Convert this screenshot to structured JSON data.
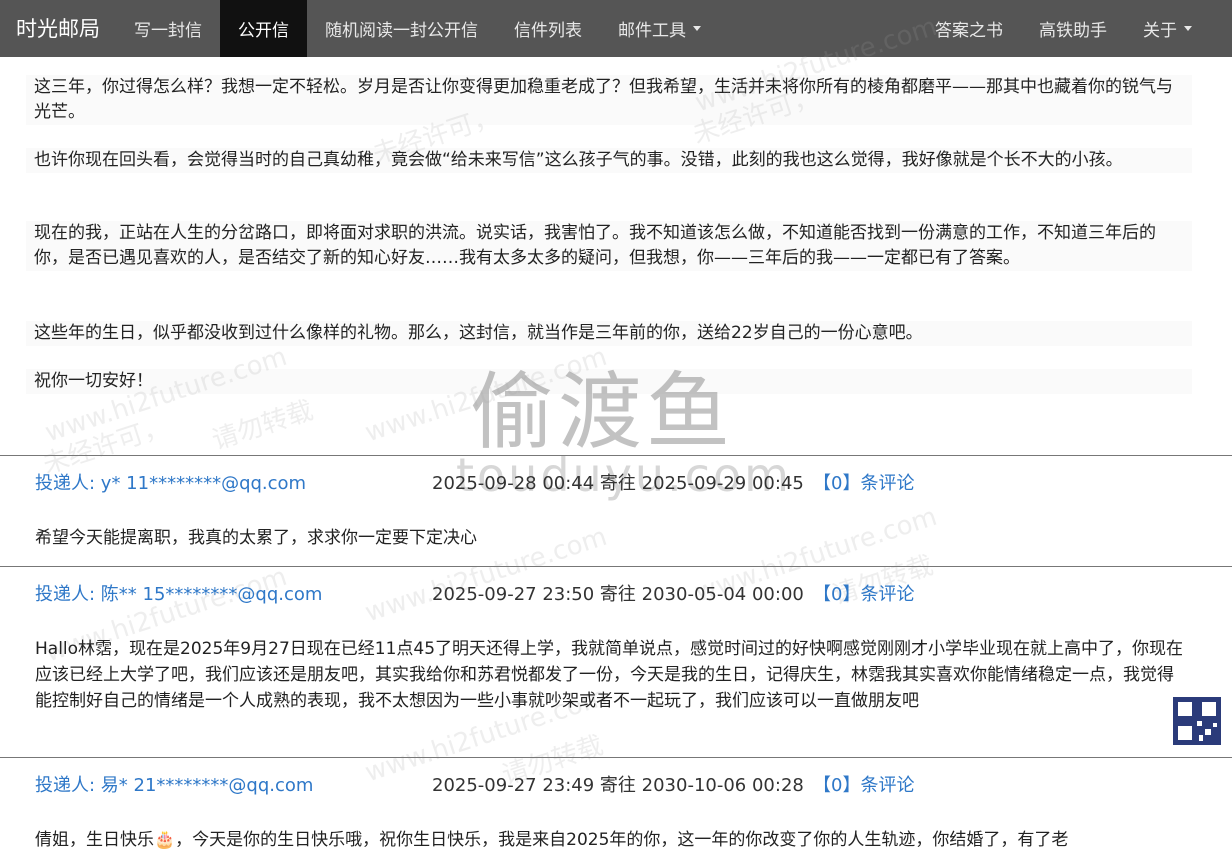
{
  "navbar": {
    "brand": "时光邮局",
    "items": [
      {
        "label": "写一封信"
      },
      {
        "label": "公开信",
        "active": true
      },
      {
        "label": "随机阅读一封公开信"
      },
      {
        "label": "信件列表"
      },
      {
        "label": "邮件工具",
        "dropdown": true
      }
    ],
    "right_items": [
      {
        "label": "答案之书"
      },
      {
        "label": "高铁助手"
      },
      {
        "label": "关于",
        "dropdown": true
      }
    ]
  },
  "letter": {
    "paragraphs": [
      "这三年，你过得怎么样？我想一定不轻松。岁月是否让你变得更加稳重老成了？但我希望，生活并未将你所有的棱角都磨平——那其中也藏着你的锐气与光芒。",
      "也许你现在回头看，会觉得当时的自己真幼稚，竟会做“给未来写信”这么孩子气的事。没错，此刻的我也这么觉得，我好像就是个长不大的小孩。",
      "现在的我，正站在人生的分岔路口，即将面对求职的洪流。说实话，我害怕了。我不知道该怎么做，不知道能否找到一份满意的工作，不知道三年后的你，是否已遇见喜欢的人，是否结交了新的知心好友……我有太多太多的疑问，但我想，你——三年后的我——一定都已有了答案。",
      "这些年的生日，似乎都没收到过什么像样的礼物。那么，这封信，就当作是三年前的你，送给22岁自己的一份心意吧。",
      "祝你一切安好！"
    ]
  },
  "watermark": {
    "big": "偷渡鱼",
    "big_sub": "touduyu.com",
    "site": "www.hi2future.com",
    "notice1": "未经许可，",
    "notice2": "请勿转载"
  },
  "entries": [
    {
      "sender": "投递人: y* 11********@qq.com",
      "time": "2025-09-28 00:44 寄往 2025-09-29 00:45",
      "comments": "【0】条评论",
      "message": "希望今天能提离职，我真的太累了，求求你一定要下定决心"
    },
    {
      "sender": "投递人: 陈** 15********@qq.com",
      "time": "2025-09-27 23:50 寄往 2030-05-04 00:00",
      "comments": "【0】条评论",
      "message": "Hallo林霑，现在是2025年9月27日现在已经11点45了明天还得上学，我就简单说点，感觉时间过的好快啊感觉刚刚才小学毕业现在就上高中了，你现在应该已经上大学了吧，我们应该还是朋友吧，其实我给你和苏君悦都发了一份，今天是我的生日，记得庆生，林霑我其实喜欢你能情绪稳定一点，我觉得能控制好自己的情绪是一个人成熟的表现，我不太想因为一些小事就吵架或者不一起玩了，我们应该可以一直做朋友吧"
    },
    {
      "sender": "投递人: 易* 21********@qq.com",
      "time": "2025-09-27 23:49 寄往 2030-10-06 00:28",
      "comments": "【0】条评论",
      "message": "倩姐，生日快乐🎂，今天是你的生日快乐哦，祝你生日快乐，我是来自2025年的你，这一年的你改变了你的人生轨迹，你结婚了，有了老"
    }
  ]
}
